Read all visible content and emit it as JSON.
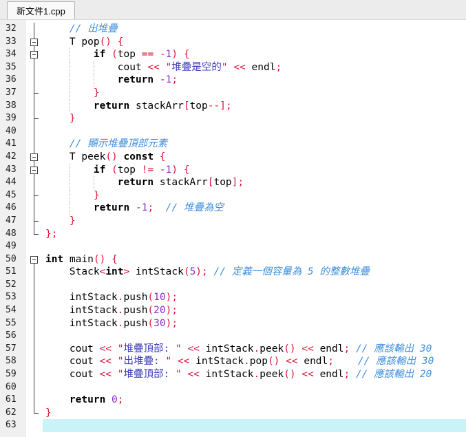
{
  "tab": {
    "label": "新文件1.cpp"
  },
  "colors": {
    "operator": "#dc1437",
    "number": "#8b2fc9",
    "comment": "#3e8ede",
    "string_cjk": "#3c3cbb",
    "keyword": "#000000",
    "gutter_bg": "#f0f0f0",
    "gutter_text": "#1c1c1c",
    "fold_glyph": "#3c3c3c",
    "active_line_bg": "#c9f3f6",
    "indent_guide": "#b5b5b5",
    "tabbar_bg": "#ececec",
    "tab_bg": "#f9f9f9",
    "tab_border": "#b0b0b0"
  },
  "editor": {
    "active_line": 63,
    "lines": [
      {
        "n": 32,
        "fold": "line",
        "guides": [],
        "t": [
          [
            "ws",
            "    "
          ],
          [
            "cm",
            "// 出堆疊"
          ]
        ]
      },
      {
        "n": 33,
        "fold": "box-mid",
        "guides": [],
        "t": [
          [
            "ws",
            "    "
          ],
          [
            "pl",
            "T pop"
          ],
          [
            "op",
            "() {"
          ]
        ]
      },
      {
        "n": 34,
        "fold": "box-mid",
        "guides": [
          4
        ],
        "t": [
          [
            "ws",
            "        "
          ],
          [
            "kw",
            "if"
          ],
          [
            "ws",
            " "
          ],
          [
            "op",
            "("
          ],
          [
            "pl",
            "top"
          ],
          [
            "ws",
            " "
          ],
          [
            "op",
            "=="
          ],
          [
            "ws",
            " "
          ],
          [
            "op",
            "-"
          ],
          [
            "num",
            "1"
          ],
          [
            "op",
            ")"
          ],
          [
            "ws",
            " "
          ],
          [
            "op",
            "{"
          ]
        ]
      },
      {
        "n": 35,
        "fold": "line",
        "guides": [
          4,
          8
        ],
        "t": [
          [
            "ws",
            "            "
          ],
          [
            "pl",
            "cout"
          ],
          [
            "ws",
            " "
          ],
          [
            "op",
            "<<"
          ],
          [
            "ws",
            " "
          ],
          [
            "sq",
            "\""
          ],
          [
            "sc",
            "堆疊是空的"
          ],
          [
            "sq",
            "\""
          ],
          [
            "ws",
            " "
          ],
          [
            "op",
            "<<"
          ],
          [
            "ws",
            " "
          ],
          [
            "pl",
            "endl"
          ],
          [
            "op",
            ";"
          ]
        ]
      },
      {
        "n": 36,
        "fold": "line",
        "guides": [
          4,
          8
        ],
        "t": [
          [
            "ws",
            "            "
          ],
          [
            "kw",
            "return"
          ],
          [
            "ws",
            " "
          ],
          [
            "op",
            "-"
          ],
          [
            "num",
            "1"
          ],
          [
            "op",
            ";"
          ]
        ]
      },
      {
        "n": 37,
        "fold": "tick",
        "guides": [
          4
        ],
        "t": [
          [
            "ws",
            "        "
          ],
          [
            "op",
            "}"
          ]
        ]
      },
      {
        "n": 38,
        "fold": "line",
        "guides": [
          4
        ],
        "t": [
          [
            "ws",
            "        "
          ],
          [
            "kw",
            "return"
          ],
          [
            "ws",
            " "
          ],
          [
            "pl",
            "stackArr"
          ],
          [
            "op",
            "["
          ],
          [
            "pl",
            "top"
          ],
          [
            "op",
            "--];"
          ]
        ]
      },
      {
        "n": 39,
        "fold": "tick",
        "guides": [],
        "t": [
          [
            "ws",
            "    "
          ],
          [
            "op",
            "}"
          ]
        ]
      },
      {
        "n": 40,
        "fold": "line",
        "guides": [],
        "t": []
      },
      {
        "n": 41,
        "fold": "line",
        "guides": [],
        "t": [
          [
            "ws",
            "    "
          ],
          [
            "cm",
            "// 顯示堆疊頂部元素"
          ]
        ]
      },
      {
        "n": 42,
        "fold": "box-mid",
        "guides": [],
        "t": [
          [
            "ws",
            "    "
          ],
          [
            "pl",
            "T peek"
          ],
          [
            "op",
            "()"
          ],
          [
            "ws",
            " "
          ],
          [
            "kw",
            "const"
          ],
          [
            "ws",
            " "
          ],
          [
            "op",
            "{"
          ]
        ]
      },
      {
        "n": 43,
        "fold": "box-mid",
        "guides": [
          4
        ],
        "t": [
          [
            "ws",
            "        "
          ],
          [
            "kw",
            "if"
          ],
          [
            "ws",
            " "
          ],
          [
            "op",
            "("
          ],
          [
            "pl",
            "top"
          ],
          [
            "ws",
            " "
          ],
          [
            "op",
            "!="
          ],
          [
            "ws",
            " "
          ],
          [
            "op",
            "-"
          ],
          [
            "num",
            "1"
          ],
          [
            "op",
            ")"
          ],
          [
            "ws",
            " "
          ],
          [
            "op",
            "{"
          ]
        ]
      },
      {
        "n": 44,
        "fold": "line",
        "guides": [
          4,
          8
        ],
        "t": [
          [
            "ws",
            "            "
          ],
          [
            "kw",
            "return"
          ],
          [
            "ws",
            " "
          ],
          [
            "pl",
            "stackArr"
          ],
          [
            "op",
            "["
          ],
          [
            "pl",
            "top"
          ],
          [
            "op",
            "];"
          ]
        ]
      },
      {
        "n": 45,
        "fold": "tick",
        "guides": [
          4
        ],
        "t": [
          [
            "ws",
            "        "
          ],
          [
            "op",
            "}"
          ]
        ]
      },
      {
        "n": 46,
        "fold": "line",
        "guides": [
          4
        ],
        "t": [
          [
            "ws",
            "        "
          ],
          [
            "kw",
            "return"
          ],
          [
            "ws",
            " "
          ],
          [
            "op",
            "-"
          ],
          [
            "num",
            "1"
          ],
          [
            "op",
            ";"
          ],
          [
            "ws",
            "  "
          ],
          [
            "cm",
            "// 堆疊為空"
          ]
        ]
      },
      {
        "n": 47,
        "fold": "tick",
        "guides": [],
        "t": [
          [
            "ws",
            "    "
          ],
          [
            "op",
            "}"
          ]
        ]
      },
      {
        "n": 48,
        "fold": "end",
        "guides": [],
        "t": [
          [
            "op",
            "};"
          ]
        ]
      },
      {
        "n": 49,
        "fold": "none",
        "guides": [],
        "t": []
      },
      {
        "n": 50,
        "fold": "box-start",
        "guides": [],
        "t": [
          [
            "kw",
            "int"
          ],
          [
            "ws",
            " "
          ],
          [
            "pl",
            "main"
          ],
          [
            "op",
            "()"
          ],
          [
            "ws",
            " "
          ],
          [
            "op",
            "{"
          ]
        ]
      },
      {
        "n": 51,
        "fold": "line",
        "guides": [],
        "t": [
          [
            "ws",
            "    "
          ],
          [
            "pl",
            "Stack"
          ],
          [
            "op",
            "<"
          ],
          [
            "kw",
            "int"
          ],
          [
            "op",
            ">"
          ],
          [
            "ws",
            " "
          ],
          [
            "pl",
            "intStack"
          ],
          [
            "op",
            "("
          ],
          [
            "num",
            "5"
          ],
          [
            "op",
            ");"
          ],
          [
            "ws",
            " "
          ],
          [
            "cm",
            "// 定義一個容量為 5 的整數堆疊"
          ]
        ]
      },
      {
        "n": 52,
        "fold": "line",
        "guides": [],
        "t": []
      },
      {
        "n": 53,
        "fold": "line",
        "guides": [],
        "t": [
          [
            "ws",
            "    "
          ],
          [
            "pl",
            "intStack"
          ],
          [
            "op",
            "."
          ],
          [
            "pl",
            "push"
          ],
          [
            "op",
            "("
          ],
          [
            "num",
            "10"
          ],
          [
            "op",
            ");"
          ]
        ]
      },
      {
        "n": 54,
        "fold": "line",
        "guides": [],
        "t": [
          [
            "ws",
            "    "
          ],
          [
            "pl",
            "intStack"
          ],
          [
            "op",
            "."
          ],
          [
            "pl",
            "push"
          ],
          [
            "op",
            "("
          ],
          [
            "num",
            "20"
          ],
          [
            "op",
            ");"
          ]
        ]
      },
      {
        "n": 55,
        "fold": "line",
        "guides": [],
        "t": [
          [
            "ws",
            "    "
          ],
          [
            "pl",
            "intStack"
          ],
          [
            "op",
            "."
          ],
          [
            "pl",
            "push"
          ],
          [
            "op",
            "("
          ],
          [
            "num",
            "30"
          ],
          [
            "op",
            ");"
          ]
        ]
      },
      {
        "n": 56,
        "fold": "line",
        "guides": [],
        "t": []
      },
      {
        "n": 57,
        "fold": "line",
        "guides": [],
        "t": [
          [
            "ws",
            "    "
          ],
          [
            "pl",
            "cout"
          ],
          [
            "ws",
            " "
          ],
          [
            "op",
            "<<"
          ],
          [
            "ws",
            " "
          ],
          [
            "sq",
            "\""
          ],
          [
            "sc",
            "堆疊頂部: "
          ],
          [
            "sq",
            "\""
          ],
          [
            "ws",
            " "
          ],
          [
            "op",
            "<<"
          ],
          [
            "ws",
            " "
          ],
          [
            "pl",
            "intStack"
          ],
          [
            "op",
            "."
          ],
          [
            "pl",
            "peek"
          ],
          [
            "op",
            "()"
          ],
          [
            "ws",
            " "
          ],
          [
            "op",
            "<<"
          ],
          [
            "ws",
            " "
          ],
          [
            "pl",
            "endl"
          ],
          [
            "op",
            ";"
          ],
          [
            "ws",
            " "
          ],
          [
            "cm",
            "// 應該輸出 30"
          ]
        ]
      },
      {
        "n": 58,
        "fold": "line",
        "guides": [],
        "t": [
          [
            "ws",
            "    "
          ],
          [
            "pl",
            "cout"
          ],
          [
            "ws",
            " "
          ],
          [
            "op",
            "<<"
          ],
          [
            "ws",
            " "
          ],
          [
            "sq",
            "\""
          ],
          [
            "sc",
            "出堆疊: "
          ],
          [
            "sq",
            "\""
          ],
          [
            "ws",
            " "
          ],
          [
            "op",
            "<<"
          ],
          [
            "ws",
            " "
          ],
          [
            "pl",
            "intStack"
          ],
          [
            "op",
            "."
          ],
          [
            "pl",
            "pop"
          ],
          [
            "op",
            "()"
          ],
          [
            "ws",
            " "
          ],
          [
            "op",
            "<<"
          ],
          [
            "ws",
            " "
          ],
          [
            "pl",
            "endl"
          ],
          [
            "op",
            ";"
          ],
          [
            "ws",
            "    "
          ],
          [
            "cm",
            "// 應該輸出 30"
          ]
        ]
      },
      {
        "n": 59,
        "fold": "line",
        "guides": [],
        "t": [
          [
            "ws",
            "    "
          ],
          [
            "pl",
            "cout"
          ],
          [
            "ws",
            " "
          ],
          [
            "op",
            "<<"
          ],
          [
            "ws",
            " "
          ],
          [
            "sq",
            "\""
          ],
          [
            "sc",
            "堆疊頂部: "
          ],
          [
            "sq",
            "\""
          ],
          [
            "ws",
            " "
          ],
          [
            "op",
            "<<"
          ],
          [
            "ws",
            " "
          ],
          [
            "pl",
            "intStack"
          ],
          [
            "op",
            "."
          ],
          [
            "pl",
            "peek"
          ],
          [
            "op",
            "()"
          ],
          [
            "ws",
            " "
          ],
          [
            "op",
            "<<"
          ],
          [
            "ws",
            " "
          ],
          [
            "pl",
            "endl"
          ],
          [
            "op",
            ";"
          ],
          [
            "ws",
            " "
          ],
          [
            "cm",
            "// 應該輸出 20"
          ]
        ]
      },
      {
        "n": 60,
        "fold": "line",
        "guides": [],
        "t": []
      },
      {
        "n": 61,
        "fold": "line",
        "guides": [],
        "t": [
          [
            "ws",
            "    "
          ],
          [
            "kw",
            "return"
          ],
          [
            "ws",
            " "
          ],
          [
            "num",
            "0"
          ],
          [
            "op",
            ";"
          ]
        ]
      },
      {
        "n": 62,
        "fold": "end",
        "guides": [],
        "t": [
          [
            "op",
            "}"
          ]
        ]
      },
      {
        "n": 63,
        "fold": "none",
        "guides": [],
        "t": [],
        "active": true
      }
    ]
  }
}
